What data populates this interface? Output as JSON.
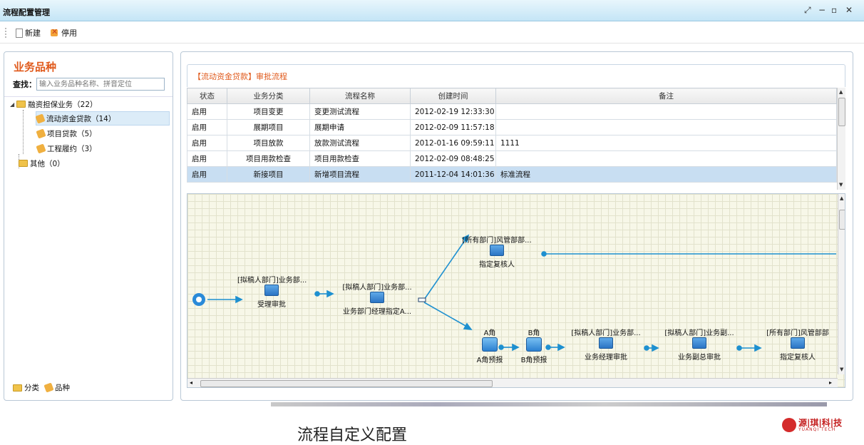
{
  "window": {
    "title": "流程配置管理",
    "controls": [
      "⤢",
      "−",
      "▫",
      "✕"
    ]
  },
  "toolbar": {
    "new_label": "新建",
    "stop_label": "停用"
  },
  "left": {
    "title": "业务品种",
    "search_label": "查找：",
    "search_placeholder": "输入业务品种名称、拼音定位",
    "tree": [
      {
        "label": "融资担保业务（22）",
        "children": [
          {
            "label": "流动资金贷款（14）",
            "selected": true
          },
          {
            "label": "项目贷款（5）"
          },
          {
            "label": "工程履约（3）"
          }
        ]
      },
      {
        "label": "其他（0）",
        "children": []
      }
    ],
    "footer": {
      "category": "分类",
      "variety": "品种"
    }
  },
  "grid": {
    "title": "【流动资金贷款】审批流程",
    "columns": [
      "状态",
      "业务分类",
      "流程名称",
      "创建时间",
      "备注"
    ],
    "rows": [
      [
        "启用",
        "项目变更",
        "变更测试流程",
        "2012-02-19 12:33:30",
        ""
      ],
      [
        "启用",
        "展期项目",
        "展期申请",
        "2012-02-09 11:57:18",
        ""
      ],
      [
        "启用",
        "项目放款",
        "放款测试流程",
        "2012-01-16 09:59:11",
        "1111"
      ],
      [
        "启用",
        "项目用款检查",
        "项目用款检查",
        "2012-02-09 08:48:25",
        ""
      ],
      [
        "启用",
        "新接项目",
        "新增项目流程",
        "2011-12-04 14:01:36",
        "标准流程"
      ]
    ],
    "selected_row": 4
  },
  "flow": {
    "nodes": [
      {
        "top": "[拟稿人部门]业务部...",
        "bottom": "受理审批"
      },
      {
        "top": "[拟稿人部门]业务部...",
        "bottom": "业务部门经理指定A..."
      },
      {
        "top": "[所有部门]风管部部...",
        "bottom": "指定复核人"
      },
      {
        "top": "A角",
        "bottom": "A角预报"
      },
      {
        "top": "B角",
        "bottom": "B角预报"
      },
      {
        "top": "[拟稿人部门]业务部...",
        "bottom": "业务经理审批"
      },
      {
        "top": "[拟稿人部门]业务副...",
        "bottom": "业务副总审批"
      },
      {
        "top": "[所有部门]风管部部",
        "bottom": "指定复核人"
      }
    ]
  },
  "caption": "流程自定义配置",
  "logo": {
    "name": "源|琪|科|技",
    "sub": "YUANQI TECH"
  },
  "colors": {
    "accent": "#e05a1c",
    "titlebar": "#c4e5f6",
    "flowline": "#1e90d0"
  }
}
